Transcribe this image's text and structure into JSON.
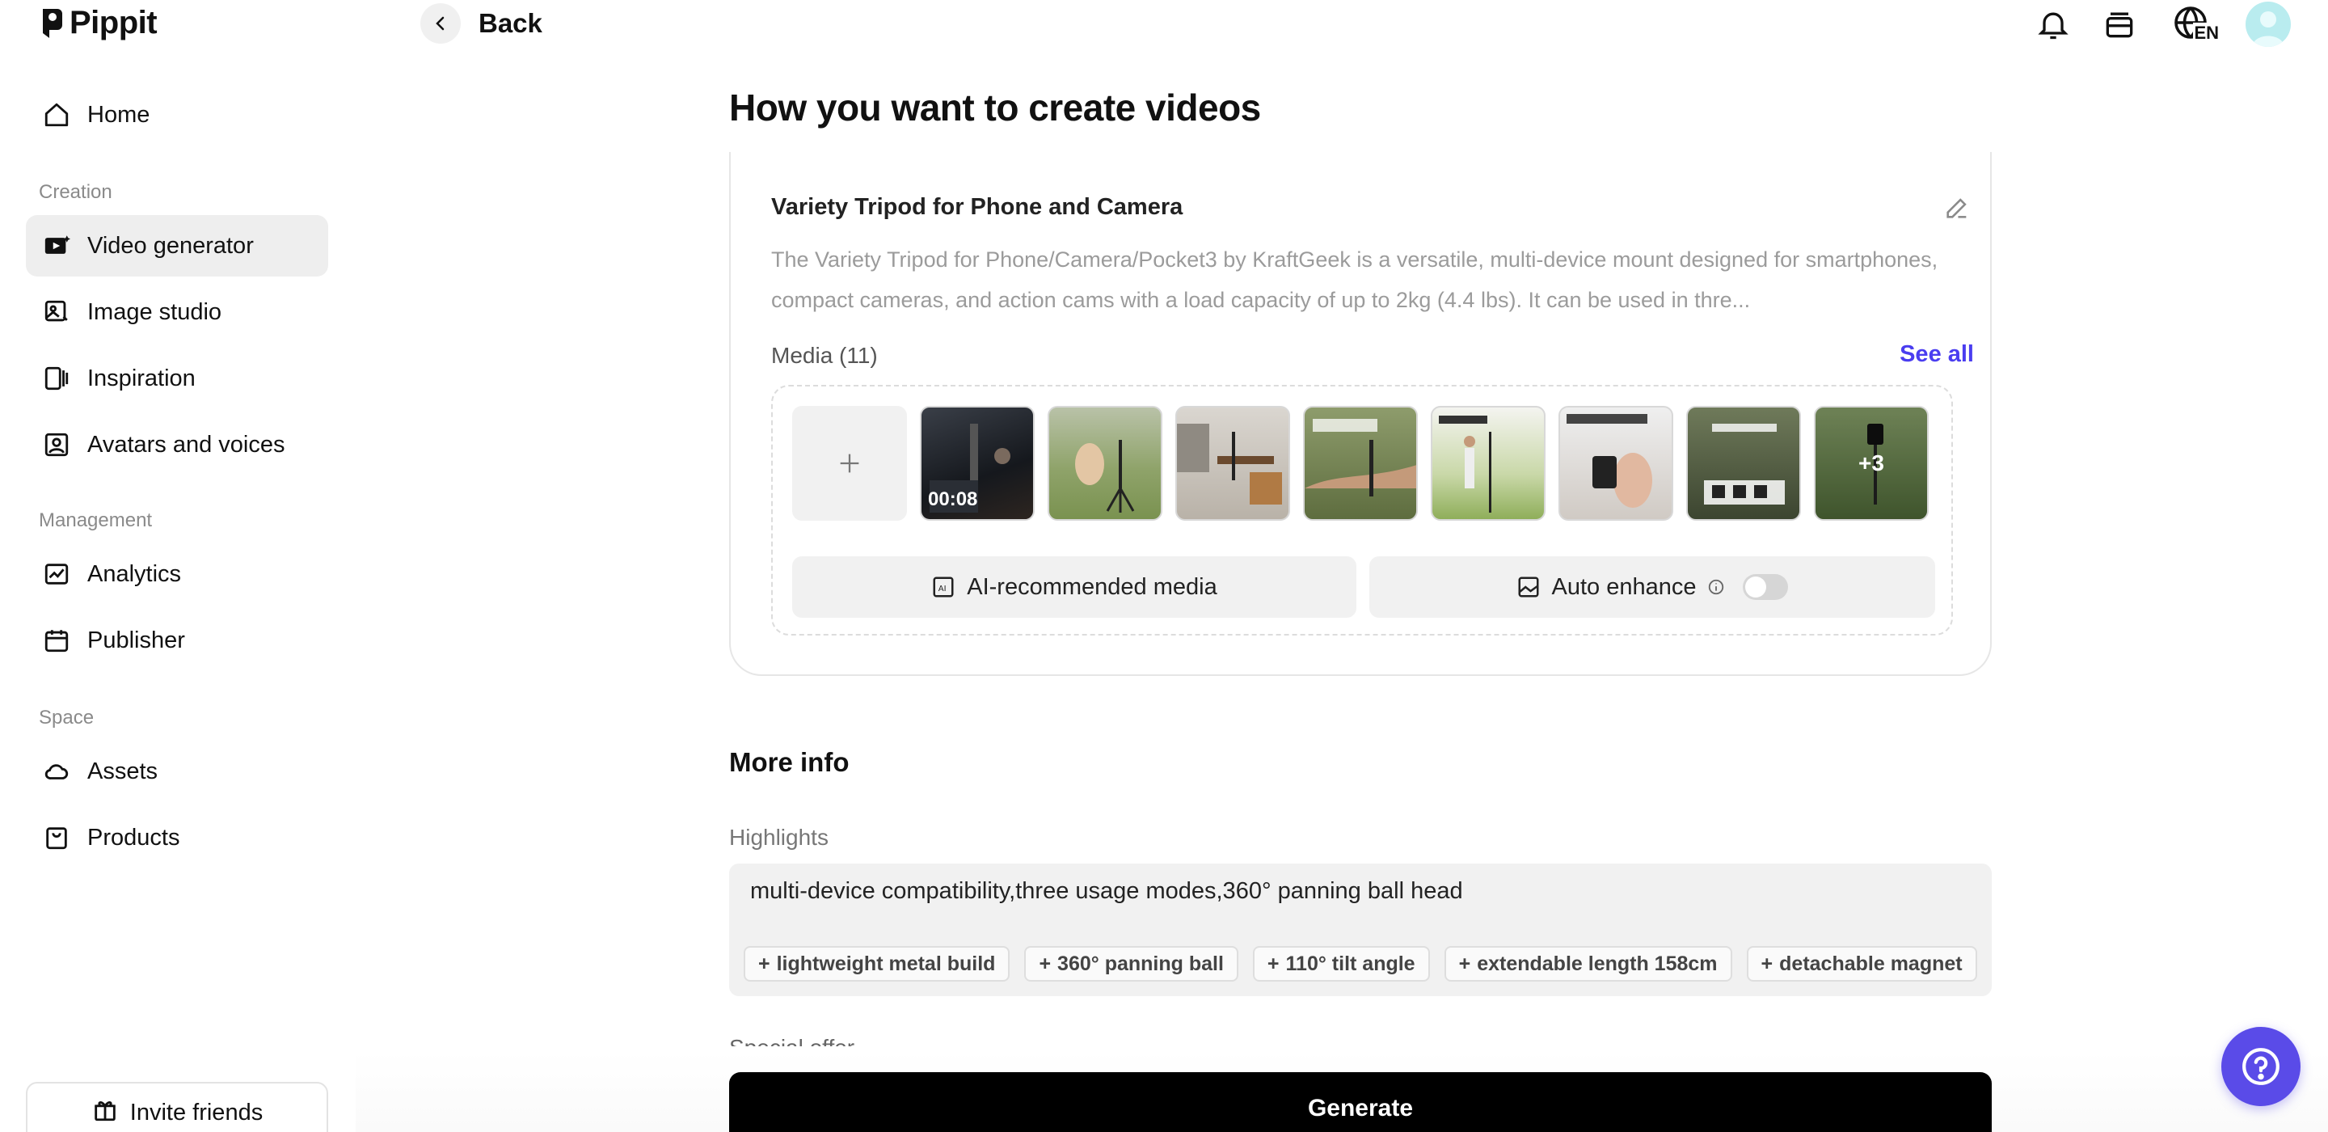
{
  "app": {
    "name": "Pippit"
  },
  "sidebar": {
    "home": "Home",
    "sections": {
      "creation": "Creation",
      "management": "Management",
      "space": "Space"
    },
    "creation_items": [
      {
        "label": "Video generator",
        "icon": "video-play-icon",
        "active": true
      },
      {
        "label": "Image studio",
        "icon": "image-edit-icon"
      },
      {
        "label": "Inspiration",
        "icon": "inspiration-icon"
      },
      {
        "label": "Avatars and voices",
        "icon": "avatar-icon"
      }
    ],
    "management_items": [
      {
        "label": "Analytics",
        "icon": "chart-icon"
      },
      {
        "label": "Publisher",
        "icon": "calendar-icon"
      }
    ],
    "space_items": [
      {
        "label": "Assets",
        "icon": "cloud-icon"
      },
      {
        "label": "Products",
        "icon": "bag-icon"
      }
    ],
    "invite": "Invite friends"
  },
  "topbar": {
    "back": "Back",
    "lang": "EN"
  },
  "main": {
    "title": "How you want to create videos",
    "product": {
      "name": "Variety Tripod for Phone and Camera",
      "description": "The Variety Tripod for Phone/Camera/Pocket3 by KraftGeek is a versatile, multi-device mount designed for smartphones, compact cameras, and action cams with a load capacity of up to 2kg (4.4 lbs). It can be used in thre..."
    },
    "media": {
      "label": "Media (11)",
      "see_all": "See all",
      "first_duration": "00:08",
      "more_count": "+3",
      "ai_recommended": "AI-recommended media",
      "auto_enhance": "Auto enhance",
      "auto_enhance_on": false
    },
    "more_info": {
      "title": "More info",
      "highlights_label": "Highlights",
      "highlights_value": "multi-device compatibility,three usage modes,360° panning ball head",
      "chips": [
        "lightweight metal build",
        "360° panning ball",
        "110° tilt angle",
        "extendable length 158cm",
        "detachable magnet"
      ],
      "special_offer": "Special offer"
    },
    "generate": "Generate"
  },
  "colors": {
    "accent": "#4a3df0",
    "help_button": "#5a4be8",
    "generate_bg": "#000000"
  }
}
